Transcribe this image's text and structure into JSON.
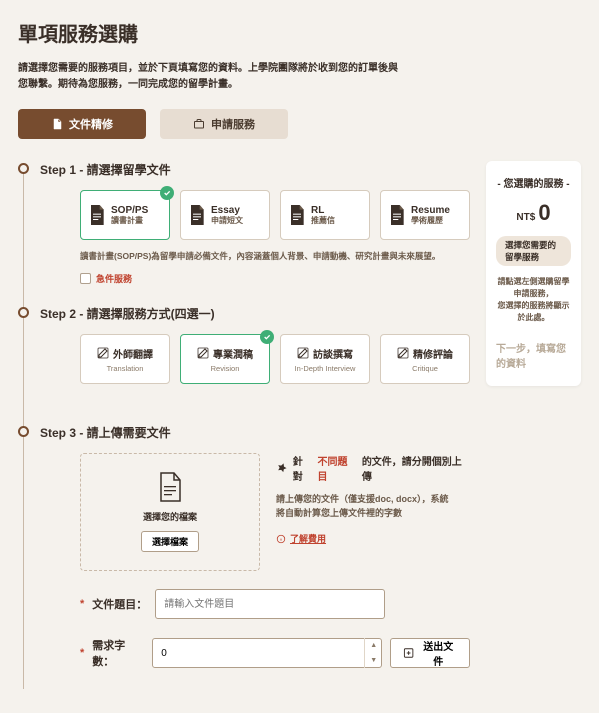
{
  "page": {
    "title": "單項服務選購",
    "intro": "請選擇您需要的服務項目，並於下頁填寫您的資料。上學院團隊將於收到您的訂單後與您聯繫。期待為您服務，一同完成您的留學計畫。"
  },
  "tabs": {
    "doc": "文件精修",
    "apply": "申請服務"
  },
  "step1": {
    "title": "Step 1 - 請選擇留學文件",
    "items": [
      {
        "title": "SOP/PS",
        "sub": "讀書計畫",
        "selected": true
      },
      {
        "title": "Essay",
        "sub": "申請短文",
        "selected": false
      },
      {
        "title": "RL",
        "sub": "推薦信",
        "selected": false
      },
      {
        "title": "Resume",
        "sub": "學術履歷",
        "selected": false
      }
    ],
    "hint": "讀書計畫(SOP/PS)為留學申請必備文件，內容涵蓋個人背景、申請動機、研究計畫與未來展望。",
    "urgent": "急件服務"
  },
  "step2": {
    "title": "Step 2 - 請選擇服務方式(四選一)",
    "items": [
      {
        "title": "外師翻譯",
        "sub": "Translation",
        "selected": false
      },
      {
        "title": "專業潤稿",
        "sub": "Revision",
        "selected": true
      },
      {
        "title": "訪談撰寫",
        "sub": "In-Depth Interview",
        "selected": false
      },
      {
        "title": "精修評論",
        "sub": "Critique",
        "selected": false
      }
    ]
  },
  "step3": {
    "title": "Step 3 - 請上傳需要文件",
    "dropzone": {
      "label": "選擇您的檔案",
      "button": "選擇檔案"
    },
    "info_head_pre": "針對",
    "info_head_orange": "不同題目",
    "info_head_post": "的文件，請分開個別上傳",
    "info_sub1": "請上傳您的文件（僅支援doc, docx），系統",
    "info_sub2": "將自動計算您上傳文件裡的字數",
    "info_link": "了解費用",
    "form": {
      "title_label": "文件題目：",
      "title_placeholder": "請輸入文件題目",
      "words_label": "需求字數：",
      "words_value": "0",
      "submit": "送出文件"
    }
  },
  "cart": {
    "title": "- 您選購的服務 -",
    "currency": "NT$",
    "amount": "0",
    "badge": "選擇您需要的留學服務",
    "hint1": "請點選左側選購留學申請服務，",
    "hint2": "您選擇的服務將顯示於此處。",
    "next": "下一步，填寫您的資料"
  }
}
